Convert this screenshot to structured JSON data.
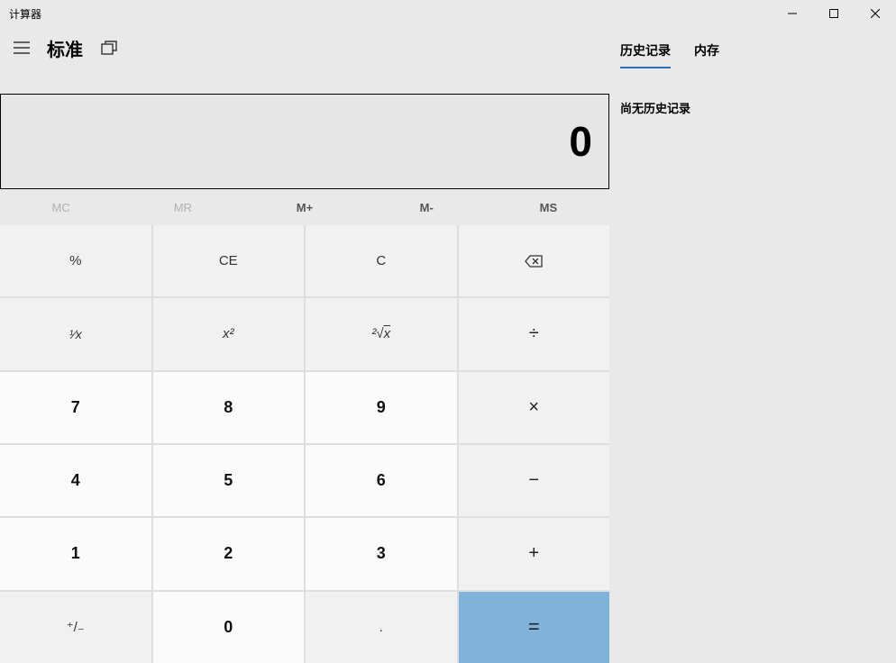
{
  "window": {
    "title": "计算器"
  },
  "toolbar": {
    "mode_title": "标准"
  },
  "display": {
    "value": "0"
  },
  "memory": {
    "mc": "MC",
    "mr": "MR",
    "mplus": "M+",
    "mminus": "M-",
    "ms": "MS"
  },
  "keys": {
    "percent": "%",
    "ce": "CE",
    "c": "C",
    "recip": "⅟ₓ",
    "square": "x²",
    "sqrt": "²√x",
    "divide": "÷",
    "multiply": "×",
    "minus": "−",
    "plus": "+",
    "equals": "=",
    "negate": "⁺/₋",
    "decimal": ".",
    "n0": "0",
    "n1": "1",
    "n2": "2",
    "n3": "3",
    "n4": "4",
    "n5": "5",
    "n6": "6",
    "n7": "7",
    "n8": "8",
    "n9": "9"
  },
  "side": {
    "tabs": {
      "history": "历史记录",
      "memory": "内存"
    },
    "history_empty": "尚无历史记录"
  }
}
